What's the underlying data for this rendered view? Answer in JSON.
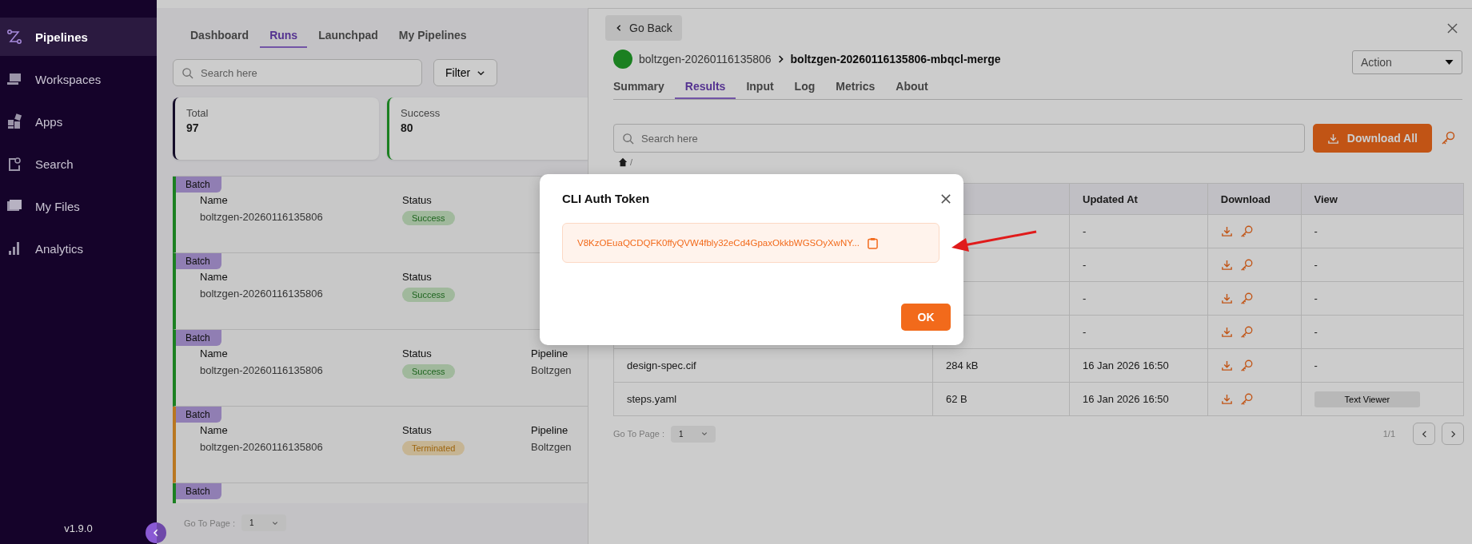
{
  "sidebar": {
    "items": [
      {
        "label": "Pipelines",
        "selected": true
      },
      {
        "label": "Workspaces",
        "selected": false
      },
      {
        "label": "Apps",
        "selected": false
      },
      {
        "label": "Search",
        "selected": false
      },
      {
        "label": "My Files",
        "selected": false
      },
      {
        "label": "Analytics",
        "selected": false
      }
    ],
    "version": "v1.9.0"
  },
  "main": {
    "tabs": [
      {
        "label": "Dashboard",
        "selected": false
      },
      {
        "label": "Runs",
        "selected": true
      },
      {
        "label": "Launchpad",
        "selected": false
      },
      {
        "label": "My Pipelines",
        "selected": false
      }
    ],
    "search": {
      "placeholder": "Search here"
    },
    "filter": "Filter",
    "stats": [
      {
        "label": "Total",
        "value": "97",
        "kind": "total"
      },
      {
        "label": "Success",
        "value": "80",
        "kind": "success"
      }
    ],
    "runs": [
      {
        "tag": "Batch",
        "name_label": "Name",
        "name": "boltzgen-20260116135806",
        "status_label": "Status",
        "status": "Success",
        "kind": "success"
      },
      {
        "tag": "Batch",
        "name_label": "Name",
        "name": "boltzgen-20260116135806",
        "status_label": "Status",
        "status": "Success",
        "kind": "success"
      },
      {
        "tag": "Batch",
        "name_label": "Name",
        "name": "boltzgen-20260116135806",
        "status_label": "Status",
        "status": "Success",
        "kind": "success",
        "pipeline_label": "Pipeline",
        "pipeline": "Boltzgen"
      },
      {
        "tag": "Batch",
        "name_label": "Name",
        "name": "boltzgen-20260116135806",
        "status_label": "Status",
        "status": "Terminated",
        "kind": "terminated",
        "pipeline_label": "Pipeline",
        "pipeline": "Boltzgen"
      },
      {
        "tag": "Batch",
        "kind": "success"
      }
    ],
    "pager": {
      "label": "Go To Page :",
      "page": "1"
    }
  },
  "drawer": {
    "back": "Go Back",
    "breadcrumb": {
      "parent": "boltzgen-20260116135806",
      "current": "boltzgen-20260116135806-mbqcl-merge",
      "kind": "success"
    },
    "action": "Action",
    "tabs": [
      {
        "label": "Summary",
        "selected": false
      },
      {
        "label": "Results",
        "selected": true
      },
      {
        "label": "Input",
        "selected": false
      },
      {
        "label": "Log",
        "selected": false
      },
      {
        "label": "Metrics",
        "selected": false
      },
      {
        "label": "About",
        "selected": false
      }
    ],
    "search": {
      "placeholder": "Search here"
    },
    "download_all": "Download All",
    "path_separator": "/",
    "table": {
      "columns": [
        "Updated At",
        "Download",
        "View"
      ],
      "rows": [
        {
          "updated": "-",
          "view": "-"
        },
        {
          "updated": "-",
          "view": "-"
        },
        {
          "updated": "-",
          "view": "-"
        },
        {
          "updated": "-",
          "view": "-"
        },
        {
          "name": "design-spec.cif",
          "size": "284 kB",
          "updated": "16 Jan 2026 16:50",
          "view": "-"
        },
        {
          "name": "steps.yaml",
          "size": "62 B",
          "updated": "16 Jan 2026 16:50",
          "view_button": "Text Viewer"
        }
      ]
    },
    "pager": {
      "label": "Go To Page :",
      "page": "1",
      "count": "1/1"
    }
  },
  "modal": {
    "title": "CLI Auth Token",
    "token": "V8KzOEuaQCDQFK0ffyQVW4fbly32eCd4GpaxOkkbWGSOyXwNY...",
    "ok": "OK"
  }
}
